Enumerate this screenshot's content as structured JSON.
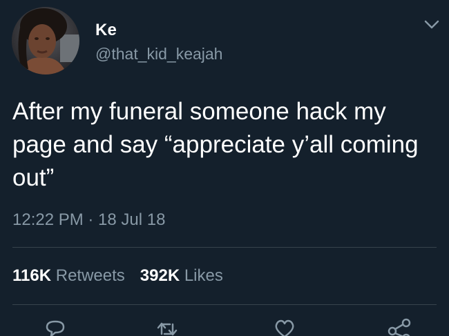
{
  "user": {
    "display_name": "Ke",
    "handle": "@that_kid_keajah",
    "avatar_icon": "profile-photo"
  },
  "tweet": {
    "text": "After my funeral someone hack my page and say “appreciate y’all coming out”",
    "timestamp": "12:22 PM · 18 Jul 18"
  },
  "stats": {
    "retweets_count": "116K",
    "retweets_label": "Retweets",
    "likes_count": "392K",
    "likes_label": "Likes"
  },
  "icons": {
    "menu": "chevron-down-icon",
    "reply": "reply-icon",
    "retweet": "retweet-icon",
    "like": "heart-icon",
    "share": "share-icon"
  },
  "colors": {
    "background": "#14202c",
    "text": "#ffffff",
    "secondary": "#8899a6",
    "divider": "#38444d"
  }
}
